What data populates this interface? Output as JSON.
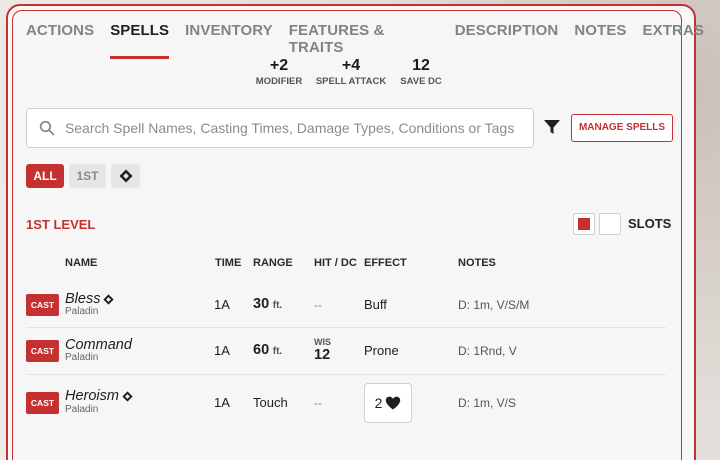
{
  "tabs": [
    {
      "label": "ACTIONS",
      "active": false
    },
    {
      "label": "SPELLS",
      "active": true
    },
    {
      "label": "INVENTORY",
      "active": false
    },
    {
      "label": "FEATURES & TRAITS",
      "active": false
    },
    {
      "label": "DESCRIPTION",
      "active": false
    },
    {
      "label": "NOTES",
      "active": false
    },
    {
      "label": "EXTRAS",
      "active": false
    }
  ],
  "stats": {
    "modifier": {
      "value": "+2",
      "label": "MODIFIER"
    },
    "spell_attack": {
      "value": "+4",
      "label": "SPELL ATTACK"
    },
    "save_dc": {
      "value": "12",
      "label": "SAVE DC"
    }
  },
  "search": {
    "placeholder": "Search Spell Names, Casting Times, Damage Types, Conditions or Tags"
  },
  "manage_label": "MANAGE SPELLS",
  "filters": {
    "all": "ALL",
    "first": "1ST"
  },
  "level": {
    "title": "1ST LEVEL",
    "slots_label": "SLOTS",
    "slots_used": 1,
    "slots_total": 2
  },
  "columns": {
    "name": "NAME",
    "time": "TIME",
    "range": "RANGE",
    "hit_dc": "HIT / DC",
    "effect": "EFFECT",
    "notes": "NOTES"
  },
  "spells": [
    {
      "cast": "CAST",
      "name": "Bless",
      "class": "Paladin",
      "time": "1A",
      "range": "30",
      "range_unit": "ft.",
      "hit": "--",
      "effect": "Buff",
      "notes": "D: 1m, V/S/M"
    },
    {
      "cast": "CAST",
      "name": "Command",
      "class": "Paladin",
      "time": "1A",
      "range": "60",
      "range_unit": "ft.",
      "save_ability": "WIS",
      "save_dc": "12",
      "effect": "Prone",
      "notes": "D: 1Rnd, V"
    },
    {
      "cast": "CAST",
      "name": "Heroism",
      "class": "Paladin",
      "time": "1A",
      "range": "Touch",
      "hit": "--",
      "effect_value": "2",
      "notes": "D: 1m, V/S"
    }
  ],
  "colors": {
    "accent": "#c53131"
  }
}
